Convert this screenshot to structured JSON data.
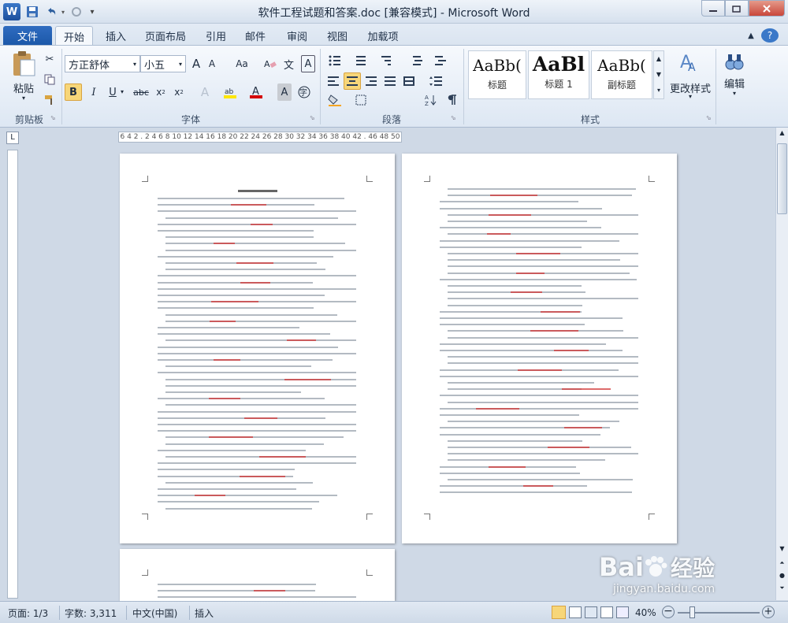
{
  "window": {
    "title": "软件工程试题和答案.doc [兼容模式] - Microsoft Word",
    "logo_letter": "W",
    "buttons": [
      "minimize",
      "restore",
      "close"
    ]
  },
  "quick_access": [
    {
      "icon": "save-icon"
    },
    {
      "icon": "undo-icon"
    },
    {
      "icon": "redo-icon"
    },
    {
      "icon": "customize-icon"
    }
  ],
  "tabs": [
    "文件",
    "开始",
    "插入",
    "页面布局",
    "引用",
    "邮件",
    "审阅",
    "视图",
    "加载项"
  ],
  "active_tab": "开始",
  "ribbon": {
    "clipboard": {
      "paste_label": "粘贴",
      "group_label": "剪贴板"
    },
    "font": {
      "font_name": "方正舒体",
      "font_size": "小五",
      "grow_label": "A",
      "shrink_label": "A",
      "case_label": "Aa",
      "bold": "B",
      "italic": "I",
      "underline": "U",
      "strike": "abc",
      "subscript": "x",
      "superscript": "x",
      "group_label": "字体"
    },
    "paragraph": {
      "group_label": "段落"
    },
    "styles": {
      "items": [
        {
          "preview": "AaBb(",
          "label": "标题"
        },
        {
          "preview": "AaBl",
          "label": "标题 1"
        },
        {
          "preview": "AaBb(",
          "label": "副标题"
        }
      ],
      "change_styles": "更改样式",
      "group_label": "样式"
    },
    "editing": {
      "label": "编辑"
    }
  },
  "ruler": {
    "text": "6 4 2 . 2 4 6 8 10 12 14 16 18 20 22 24 26 28 30 32 34 36 38 40 42 . 46 48 50"
  },
  "status": {
    "page": "页面: 1/3",
    "words": "字数: 3,311",
    "language": "中文(中国)",
    "mode": "插入",
    "zoom": "40%"
  },
  "watermark": {
    "brand": "Bai",
    "brand2": "经验",
    "url": "jingyan.baidu.com"
  },
  "colors": {
    "accent": "#1b57a8",
    "answer_red": "#d23a3a"
  }
}
